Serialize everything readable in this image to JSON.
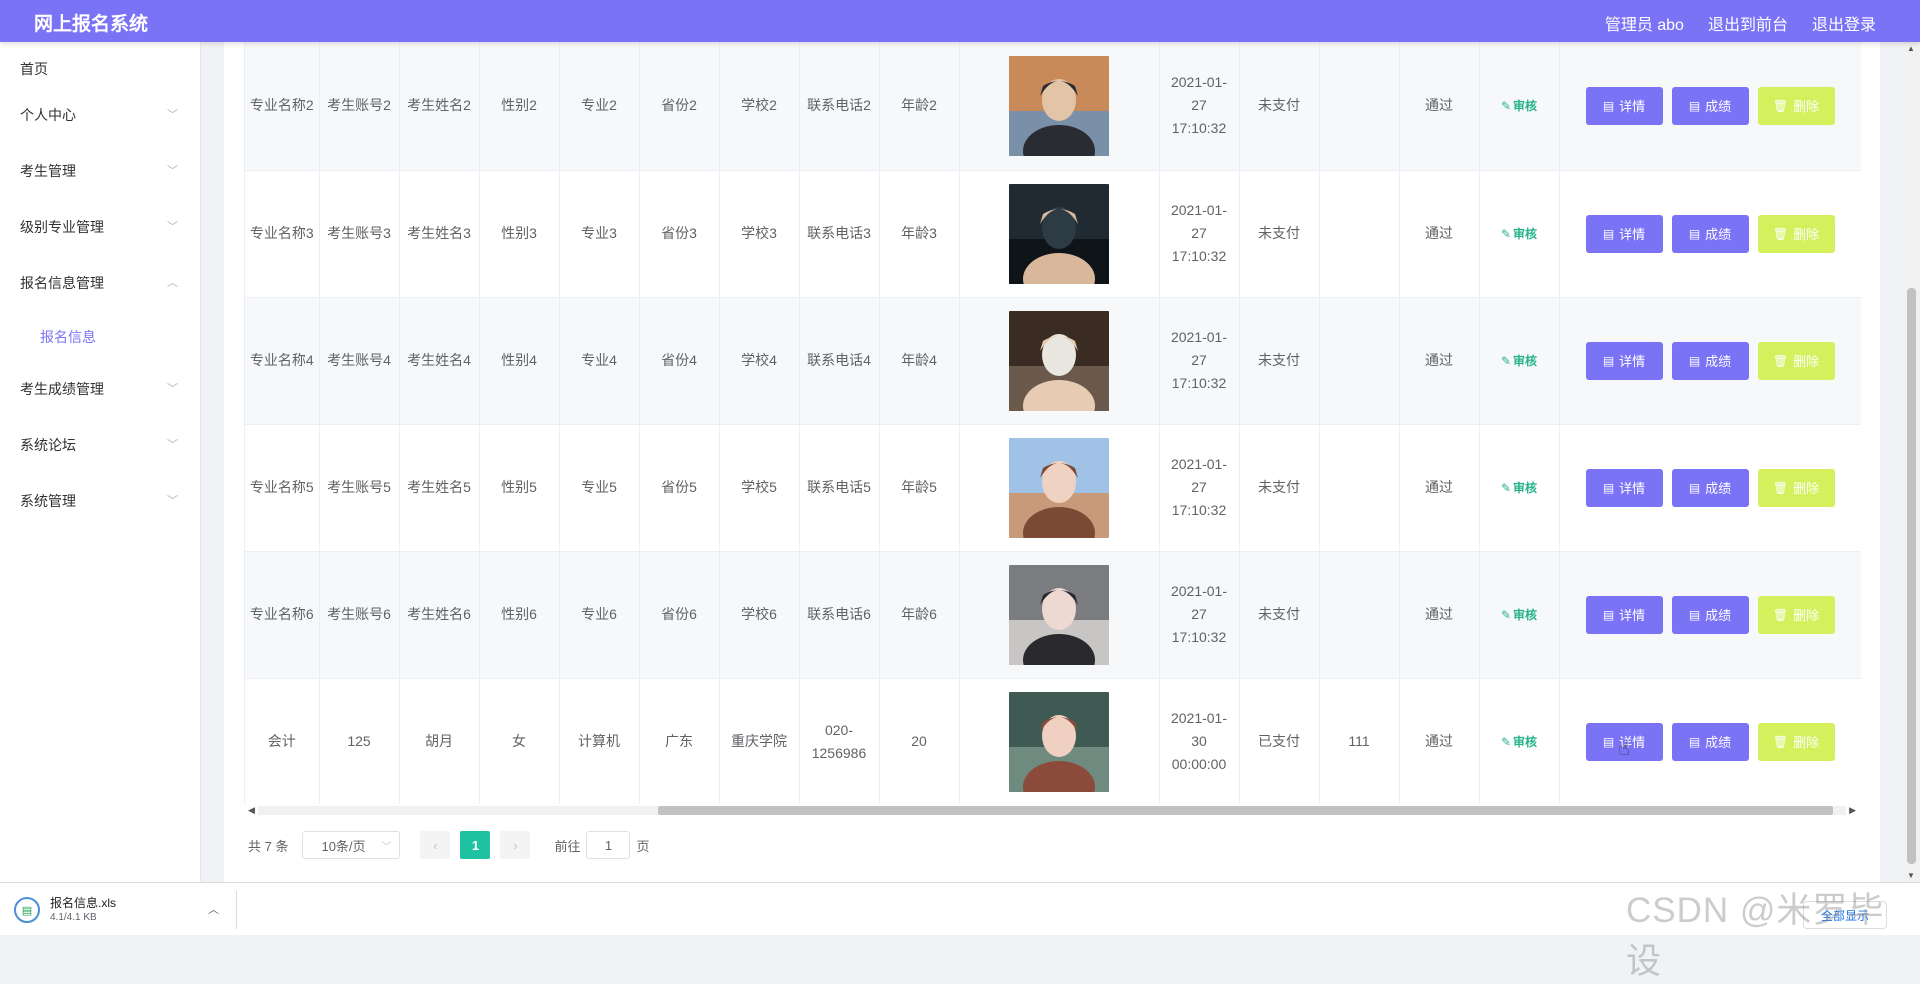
{
  "header": {
    "title": "网上报名系统",
    "admin": "管理员 abo",
    "front_link": "退出到前台",
    "logout": "退出登录"
  },
  "sidebar": {
    "items": [
      {
        "label": "首页"
      },
      {
        "label": "个人中心"
      },
      {
        "label": "考生管理"
      },
      {
        "label": "级别专业管理"
      },
      {
        "label": "报名信息管理"
      },
      {
        "label": "报名信息"
      },
      {
        "label": "考生成绩管理"
      },
      {
        "label": "系统论坛"
      },
      {
        "label": "系统管理"
      }
    ]
  },
  "table": {
    "audit_label": "审核",
    "detail_label": "详情",
    "score_label": "成绩",
    "delete_label": "删除",
    "rows": [
      {
        "major_name": "专业名称2",
        "account": "考生账号2",
        "name": "考生姓名2",
        "gender": "性别2",
        "major": "专业2",
        "province": "省份2",
        "school": "学校2",
        "phone": "联系电话2",
        "age": "年龄2",
        "time": "2021-01-27 17:10:32",
        "pay": "未支付",
        "score": "",
        "status": "通过"
      },
      {
        "major_name": "专业名称3",
        "account": "考生账号3",
        "name": "考生姓名3",
        "gender": "性别3",
        "major": "专业3",
        "province": "省份3",
        "school": "学校3",
        "phone": "联系电话3",
        "age": "年龄3",
        "time": "2021-01-27 17:10:32",
        "pay": "未支付",
        "score": "",
        "status": "通过"
      },
      {
        "major_name": "专业名称4",
        "account": "考生账号4",
        "name": "考生姓名4",
        "gender": "性别4",
        "major": "专业4",
        "province": "省份4",
        "school": "学校4",
        "phone": "联系电话4",
        "age": "年龄4",
        "time": "2021-01-27 17:10:32",
        "pay": "未支付",
        "score": "",
        "status": "通过"
      },
      {
        "major_name": "专业名称5",
        "account": "考生账号5",
        "name": "考生姓名5",
        "gender": "性别5",
        "major": "专业5",
        "province": "省份5",
        "school": "学校5",
        "phone": "联系电话5",
        "age": "年龄5",
        "time": "2021-01-27 17:10:32",
        "pay": "未支付",
        "score": "",
        "status": "通过"
      },
      {
        "major_name": "专业名称6",
        "account": "考生账号6",
        "name": "考生姓名6",
        "gender": "性别6",
        "major": "专业6",
        "province": "省份6",
        "school": "学校6",
        "phone": "联系电话6",
        "age": "年龄6",
        "time": "2021-01-27 17:10:32",
        "pay": "未支付",
        "score": "",
        "status": "通过"
      },
      {
        "major_name": "会计",
        "account": "125",
        "name": "胡月",
        "gender": "女",
        "major": "计算机",
        "province": "广东",
        "school": "重庆学院",
        "phone": "020-1256986",
        "age": "20",
        "time": "2021-01-30 00:00:00",
        "pay": "已支付",
        "score": "111",
        "status": "通过"
      }
    ]
  },
  "pagination": {
    "total": "共 7 条",
    "page_size": "10条/页",
    "current_page": "1",
    "goto_label": "前往",
    "goto_value": "1",
    "page_unit": "页"
  },
  "download_bar": {
    "file_name": "报名信息.xls",
    "file_size": "4.1/4.1 KB",
    "show_all": "全部显示"
  },
  "watermark": "CSDN @米罗毕设",
  "colors": {
    "brand": "#7b73f6",
    "delete_button": "#d4f05c",
    "audit_text": "#29b38b",
    "active_page": "#1fc2a0"
  }
}
